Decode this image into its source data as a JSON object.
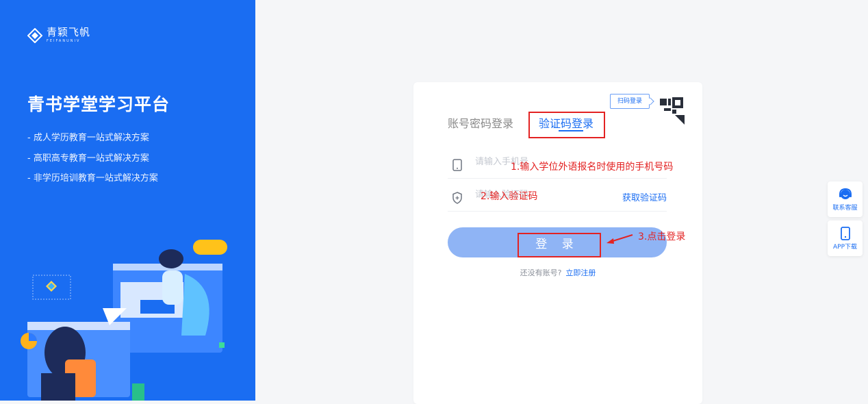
{
  "brand": {
    "name_cn": "青颖飞帆",
    "name_en": "FEIFANUNIV"
  },
  "left": {
    "title": "青书学堂学习平台",
    "features": [
      "- 成人学历教育一站式解决方案",
      "- 高职高专教育一站式解决方案",
      "- 非学历培训教育一站式解决方案"
    ]
  },
  "login": {
    "tab_password": "账号密码登录",
    "tab_code": "验证码登录",
    "qr_tip": "扫码登录",
    "phone_placeholder": "请输入手机号",
    "code_placeholder": "请输入验证码",
    "get_code": "获取验证码",
    "login_button": "登 录",
    "no_account": "还没有账号?",
    "register": "立即注册"
  },
  "annotations": {
    "step1": "1.输入学位外语报名时使用的手机号码",
    "step2": "2.输入验证码",
    "step3": "3.点击登录"
  },
  "side": {
    "service": "联系客服",
    "app": "APP下载"
  },
  "colors": {
    "primary": "#1a6df2",
    "annotation": "#e32222",
    "button": "#8fb4f5"
  }
}
